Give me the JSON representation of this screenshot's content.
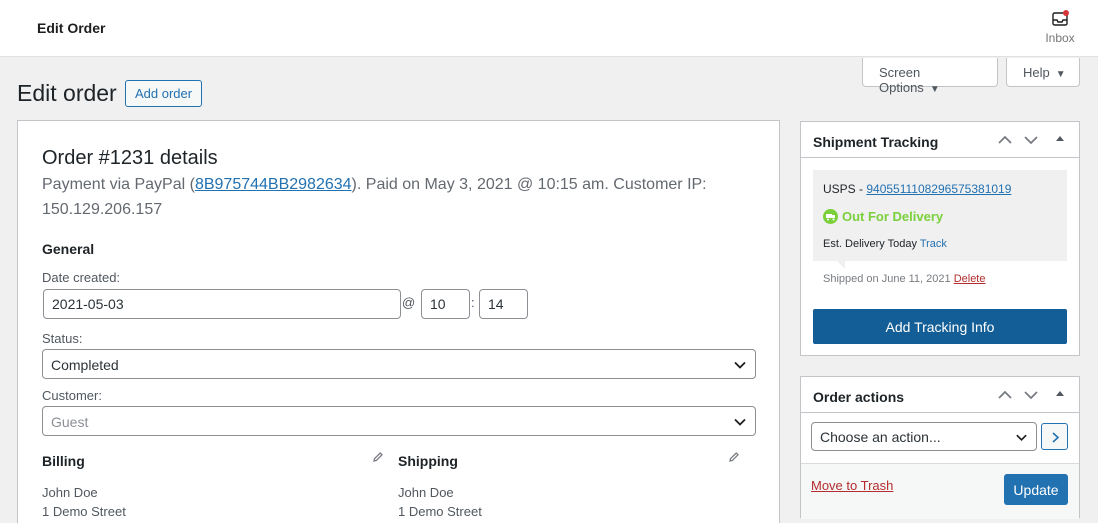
{
  "topbar": {
    "title": "Edit Order",
    "inbox_label": "Inbox",
    "inbox_dot_color": "#d63638"
  },
  "header": {
    "screen_options": "Screen Options",
    "help": "Help",
    "page_title": "Edit order",
    "add_order": "Add order"
  },
  "order": {
    "title": "Order #1231 details",
    "meta_prefix": "Payment via PayPal (",
    "transaction_id": "8B975744BB2982634",
    "meta_suffix": "). Paid on May 3, 2021 @ 10:15 am. Customer IP: 150.129.206.157",
    "general_heading": "General",
    "date_label": "Date created:",
    "date_value": "2021-05-03",
    "at_sep": "@",
    "hour": "10",
    "colon_sep": ":",
    "minute": "14",
    "status_label": "Status:",
    "status_value": "Completed",
    "customer_label": "Customer:",
    "customer_value": "Guest",
    "billing_heading": "Billing",
    "shipping_heading": "Shipping",
    "billing_lines": [
      "John Doe",
      "1 Demo Street"
    ],
    "shipping_lines": [
      "John Doe",
      "1 Demo Street"
    ]
  },
  "shipment_tracking": {
    "title": "Shipment Tracking",
    "carrier_prefix": "USPS - ",
    "tracking_number": "9405511108296575381019",
    "status": "Out For Delivery",
    "est_prefix": "Est. Delivery Today ",
    "track_link": "Track",
    "shipped_prefix": "Shipped on June 11, 2021 ",
    "delete_link": "Delete",
    "add_button": "Add Tracking Info"
  },
  "order_actions": {
    "title": "Order actions",
    "select_value": "Choose an action...",
    "move_to_trash": "Move to Trash",
    "update": "Update"
  },
  "colors": {
    "accent": "#2271b1",
    "primary_dark": "#135e96",
    "success": "#7ad03a",
    "danger": "#b32d2e"
  }
}
